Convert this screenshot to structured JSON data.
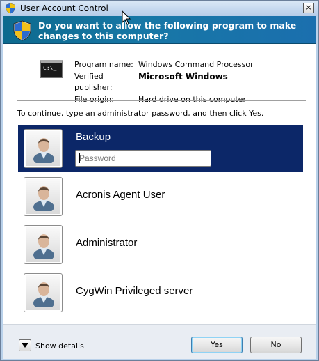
{
  "window": {
    "title": "User Account Control",
    "close_glyph": "×"
  },
  "banner": {
    "question": "Do you want to allow the following program to make changes to this computer?"
  },
  "program": {
    "cmd_icon_text": "C:\\_",
    "rows": [
      {
        "label": "Program name:",
        "value": "Windows Command Processor",
        "bold": false
      },
      {
        "label": "Verified publisher:",
        "value": "Microsoft Windows",
        "bold": true
      },
      {
        "label": "File origin:",
        "value": "Hard drive on this computer",
        "bold": false
      }
    ]
  },
  "instruction": "To continue, type an administrator password, and then click Yes.",
  "users": [
    {
      "name": "Backup",
      "selected": true
    },
    {
      "name": "Acronis Agent User",
      "selected": false
    },
    {
      "name": "Administrator",
      "selected": false
    },
    {
      "name": "CygWin Privileged server",
      "selected": false
    }
  ],
  "password": {
    "placeholder": "Password",
    "value": ""
  },
  "footer": {
    "details_label": "Show details",
    "yes_label": "Yes",
    "no_label": "No"
  },
  "colors": {
    "selected_tile": "#0c2768",
    "banner": "#1777a6",
    "window_frame": "#b9d1ea"
  },
  "icons": {
    "title": "uac-shield-icon",
    "banner": "uac-shield-icon",
    "program": "command-prompt-icon",
    "avatar": "user-avatar-icon",
    "details": "chevron-down-icon",
    "cursor": "mouse-pointer-icon"
  }
}
